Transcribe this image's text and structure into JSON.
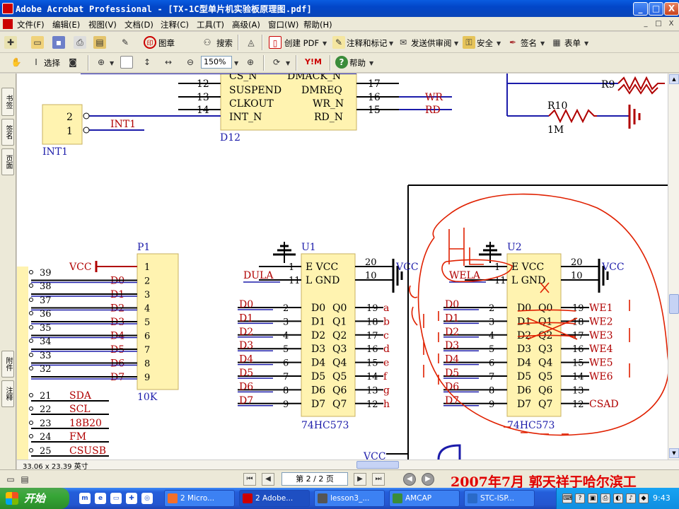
{
  "window": {
    "title": "Adobe Acrobat Professional - [TX-1C型单片机实验板原理图.pdf]",
    "buttons": [
      "_",
      "□",
      "X"
    ]
  },
  "menu": {
    "items": [
      "文件(F)",
      "编辑(E)",
      "视图(V)",
      "文档(D)",
      "注释(C)",
      "工具(T)",
      "高级(A)",
      "窗口(W)",
      "帮助(H)"
    ],
    "mdi_buttons": [
      "_",
      "□",
      "X"
    ]
  },
  "toolbar1": {
    "stamp": "图章",
    "search": "搜索",
    "create_pdf": "创建 PDF",
    "comment": "注释和标记",
    "review": "发送供审阅",
    "security": "安全",
    "sign": "签名",
    "forms": "表单"
  },
  "toolbar2": {
    "select": "选择",
    "zoom": "150%",
    "help": "帮助"
  },
  "sidebar": {
    "tabs": [
      "书签",
      "签名",
      "页面",
      "附件",
      "注释"
    ]
  },
  "schematic": {
    "d12": {
      "name": "D12",
      "left_pins": [
        "12",
        "13",
        "14"
      ],
      "pin_labels_left": [
        "CS_N",
        "SUSPEND",
        "CLKOUT",
        "INT_N"
      ],
      "pin_labels_right": [
        "DMACK_N",
        "DMREQ",
        "WR_N",
        "RD_N"
      ],
      "right_pins": [
        "17",
        "16",
        "15"
      ],
      "nets_right": [
        "WR",
        "RD"
      ]
    },
    "int1": {
      "name": "INT1",
      "pins": [
        "2",
        "1"
      ],
      "net": "INT1"
    },
    "r9": "R9",
    "r10": {
      "name": "R10",
      "value": "1M"
    },
    "p1": {
      "name": "P1",
      "value": "10K",
      "pins": [
        "1",
        "2",
        "3",
        "4",
        "5",
        "6",
        "7",
        "8",
        "9"
      ],
      "nets": [
        "VCC",
        "D0",
        "D1",
        "D2",
        "D3",
        "D4",
        "D5",
        "D6",
        "D7"
      ]
    },
    "connector": {
      "pins": [
        "39",
        "38",
        "37",
        "36",
        "35",
        "34",
        "33",
        "32",
        "21",
        "22",
        "23",
        "24",
        "25"
      ],
      "nets_lower": [
        "SDA",
        "SCL",
        "18B20",
        "FM",
        "CSUSB"
      ]
    },
    "u1": {
      "name": "U1",
      "part": "74HC573",
      "ctrl_pins": [
        "1",
        "11"
      ],
      "ctrl_labels": [
        "E VCC",
        "L GND"
      ],
      "supply_pins": [
        "20",
        "10"
      ],
      "le_net": "DULA",
      "in_pins": [
        "2",
        "3",
        "4",
        "5",
        "6",
        "7",
        "8",
        "9"
      ],
      "in_nets": [
        "D0",
        "D1",
        "D2",
        "D3",
        "D4",
        "D5",
        "D6",
        "D7"
      ],
      "d_labels": [
        "D0",
        "D1",
        "D2",
        "D3",
        "D4",
        "D5",
        "D6",
        "D7"
      ],
      "q_labels": [
        "Q0",
        "Q1",
        "Q2",
        "Q3",
        "Q4",
        "Q5",
        "Q6",
        "Q7"
      ],
      "out_pins": [
        "19",
        "18",
        "17",
        "16",
        "15",
        "14",
        "13",
        "12"
      ],
      "out_nets": [
        "a",
        "b",
        "c",
        "d",
        "e",
        "f",
        "g",
        "h"
      ],
      "vcc": "VCC"
    },
    "u2": {
      "name": "U2",
      "part": "74HC573",
      "ctrl_pins": [
        "1",
        "11"
      ],
      "ctrl_labels": [
        "E VCC",
        "L GND"
      ],
      "supply_pins": [
        "20",
        "10"
      ],
      "le_net": "WELA",
      "in_pins": [
        "2",
        "3",
        "4",
        "5",
        "6",
        "7",
        "8",
        "9"
      ],
      "in_nets": [
        "D0",
        "D1",
        "D2",
        "D3",
        "D4",
        "D5",
        "D6",
        "D7"
      ],
      "d_labels": [
        "D0",
        "D1",
        "D2",
        "D3",
        "D4",
        "D5",
        "D6",
        "D7"
      ],
      "q_labels": [
        "Q0",
        "Q1",
        "Q2",
        "Q3",
        "Q4",
        "Q5",
        "Q6",
        "Q7"
      ],
      "out_pins": [
        "19",
        "18",
        "17",
        "16",
        "15",
        "14",
        "13",
        "12"
      ],
      "out_nets": [
        "WE1",
        "WE2",
        "WE3",
        "WE4",
        "WE5",
        "WE6",
        "",
        "CSAD"
      ],
      "vcc": "VCC"
    },
    "bottom_vcc": "VCC",
    "annotation_text": "H L"
  },
  "scroll": {
    "page_size": "33.06 x 23.39 英寸"
  },
  "status": {
    "page": "第 2 / 2 页",
    "stamp_text": "2007年7月  郭天祥于哈尔滨工"
  },
  "taskbar": {
    "start": "开始",
    "tasks": [
      "2 Micro...",
      "2 Adobe...",
      "lesson3_...",
      "AMCAP",
      "STC-ISP..."
    ],
    "clock": "9:43"
  },
  "colors": {
    "wire_blue": "#1c1caa",
    "net_red": "#b00000",
    "chip_fill": "#fff3b0",
    "annotation_red": "#e02000",
    "title_blue": "#0a46c8"
  }
}
